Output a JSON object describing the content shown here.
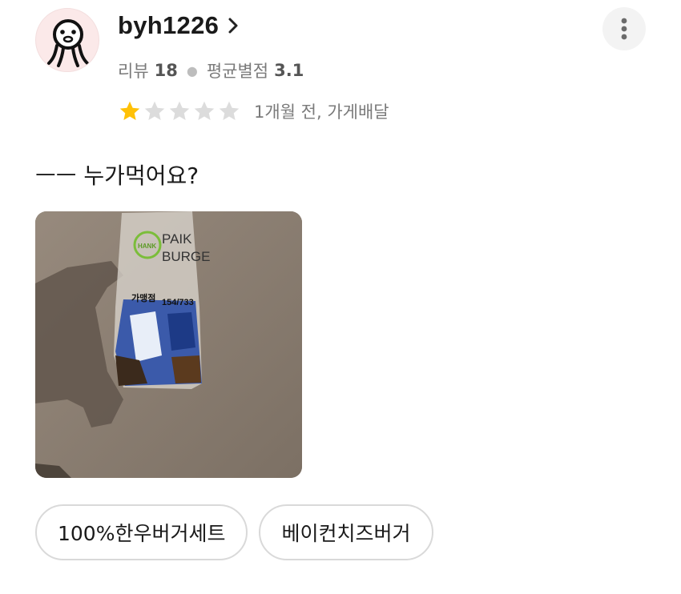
{
  "reviewer": {
    "username": "byh1226",
    "review_label": "리뷰",
    "review_count": "18",
    "avg_label": "평균별점",
    "avg_rating": "3.1"
  },
  "rating": {
    "stars": 1,
    "max_stars": 5,
    "time_ago": "1개월 전, 가게배달"
  },
  "review": {
    "text": "ㅡㅡ 누가먹어요?"
  },
  "photo": {
    "bag_brand_line1": "PAIK",
    "bag_brand_line2": "BURGE",
    "bag_logo_text": "HANK",
    "bag_order_label": "가맹점",
    "bag_order_number": "154/733"
  },
  "menu_tags": [
    {
      "label": "100%한우버거세트"
    },
    {
      "label": "베이컨치즈버거"
    }
  ],
  "icons": {
    "profile": "octopus-avatar-icon",
    "chevron": "chevron-right-icon",
    "more": "more-vertical-icon",
    "star": "star-icon"
  },
  "colors": {
    "star_filled": "#ffc107",
    "star_empty": "#dcdcdc",
    "muted_text": "#7a7a7a",
    "tag_border": "#d9d9d9",
    "avatar_bg": "#fbe9e9"
  }
}
